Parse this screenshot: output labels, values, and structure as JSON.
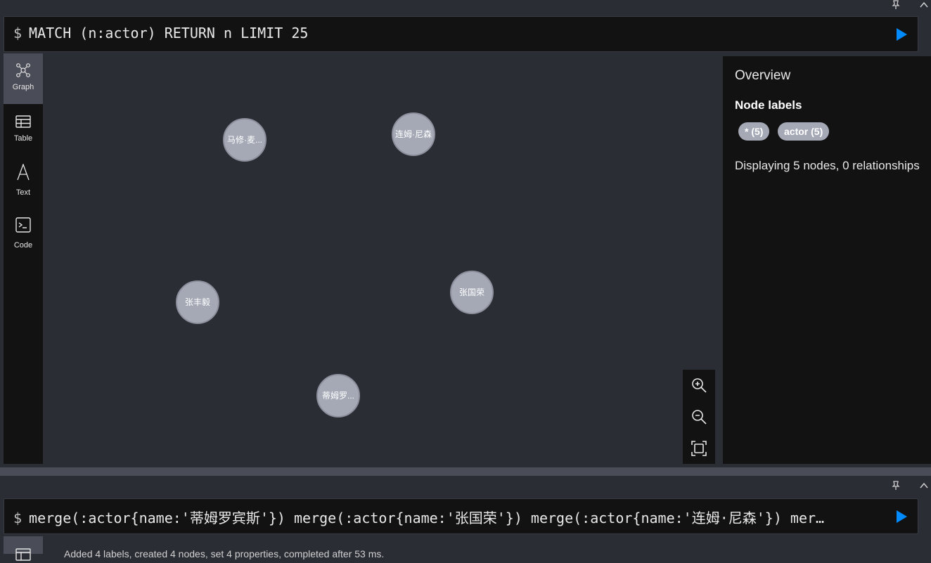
{
  "frame1": {
    "query": "MATCH (n:actor) RETURN n LIMIT 25",
    "prompt": "$",
    "sidebar": [
      {
        "label": "Graph",
        "icon": "graph-icon",
        "active": true
      },
      {
        "label": "Table",
        "icon": "table-icon",
        "active": false
      },
      {
        "label": "Text",
        "icon": "text-icon",
        "active": false
      },
      {
        "label": "Code",
        "icon": "code-icon",
        "active": false
      }
    ],
    "nodes": [
      {
        "label": "马修·麦..."
      },
      {
        "label": "连姆·尼森"
      },
      {
        "label": "张丰毅"
      },
      {
        "label": "张国荣"
      },
      {
        "label": "蒂姆罗..."
      }
    ],
    "overview": {
      "title": "Overview",
      "node_labels_heading": "Node labels",
      "labels": [
        {
          "text": "* (5)"
        },
        {
          "text": "actor (5)"
        }
      ],
      "displaying": "Displaying 5 nodes, 0 relationships"
    }
  },
  "frame2": {
    "prompt": "$",
    "query": "merge(:actor{name:'蒂姆罗宾斯'}) merge(:actor{name:'张国荣'}) merge(:actor{name:'连姆·尼森'}) mer…",
    "status": "Added 4 labels, created 4 nodes, set 4 properties, completed after 53 ms."
  },
  "colors": {
    "background": "#2b2d35",
    "panel": "#121212",
    "node_fill": "#a5a9b6",
    "run_button": "#018bff"
  }
}
